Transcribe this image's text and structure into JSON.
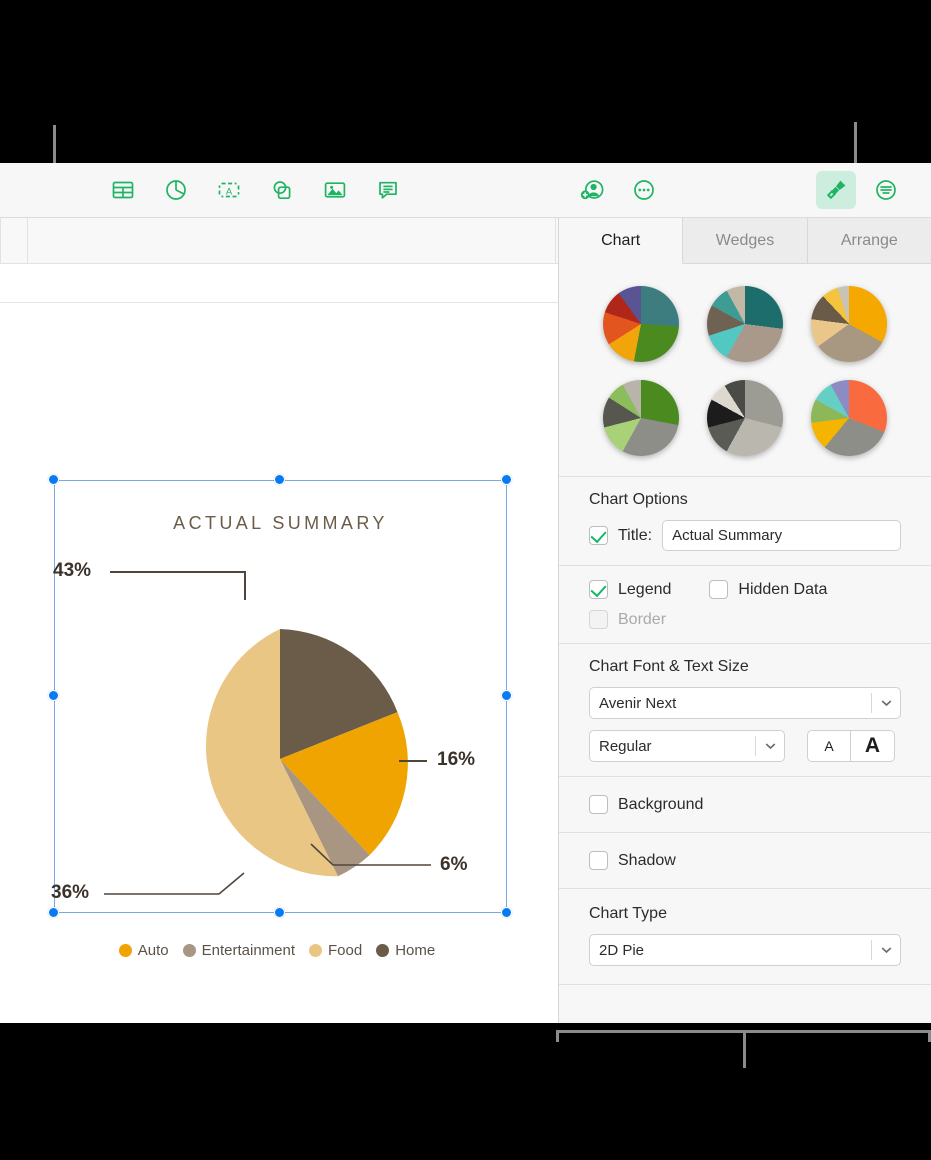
{
  "toolbar": {
    "left_items": [
      {
        "name": "table-icon",
        "label": "Table"
      },
      {
        "name": "chart-icon",
        "label": "Chart"
      },
      {
        "name": "text-box-icon",
        "label": "Text"
      },
      {
        "name": "shape-icon",
        "label": "Shape"
      },
      {
        "name": "media-icon",
        "label": "Media"
      },
      {
        "name": "comment-icon",
        "label": "Comment"
      }
    ],
    "right_items": [
      {
        "name": "collaborate-icon",
        "label": "Collaborate"
      },
      {
        "name": "more-icon",
        "label": "More"
      },
      {
        "name": "format-icon",
        "label": "Format",
        "active": true
      },
      {
        "name": "document-icon",
        "label": "Document"
      }
    ],
    "accent_color": "#1fb464",
    "active_bg": "#cdeede"
  },
  "sidebar": {
    "tabs": [
      {
        "label": "Chart",
        "active": true
      },
      {
        "label": "Wedges",
        "active": false
      },
      {
        "label": "Arrange",
        "active": false
      }
    ],
    "chart_options": {
      "heading": "Chart Options",
      "title_checkbox": {
        "label": "Title:",
        "checked": true
      },
      "title_value": "Actual Summary",
      "legend": {
        "label": "Legend",
        "checked": true
      },
      "hidden_data": {
        "label": "Hidden Data",
        "checked": false
      },
      "border": {
        "label": "Border",
        "checked": false,
        "disabled": true
      }
    },
    "font_section": {
      "heading": "Chart Font & Text Size",
      "family": "Avenir Next",
      "weight": "Regular",
      "decrease_label": "A",
      "increase_label": "A"
    },
    "background": {
      "label": "Background",
      "checked": false
    },
    "shadow": {
      "label": "Shadow",
      "checked": false
    },
    "chart_type": {
      "heading": "Chart Type",
      "value": "2D Pie"
    },
    "style_thumbnails": [
      {
        "name": "chart-style-1",
        "slices": [
          {
            "color": "#3d7d7f",
            "value": 26
          },
          {
            "color": "#4a8a1f",
            "value": 27
          },
          {
            "color": "#f2a50a",
            "value": 13
          },
          {
            "color": "#e2551f",
            "value": 14
          },
          {
            "color": "#b0271a",
            "value": 10
          },
          {
            "color": "#5b5494",
            "value": 10
          }
        ]
      },
      {
        "name": "chart-style-2",
        "slices": [
          {
            "color": "#1c6d6b",
            "value": 27
          },
          {
            "color": "#a8998a",
            "value": 31
          },
          {
            "color": "#52c8c2",
            "value": 12
          },
          {
            "color": "#6f6253",
            "value": 13
          },
          {
            "color": "#3f9c94",
            "value": 9
          },
          {
            "color": "#c3b7a6",
            "value": 8
          }
        ]
      },
      {
        "name": "chart-style-3",
        "slices": [
          {
            "color": "#f5a800",
            "value": 33
          },
          {
            "color": "#a89781",
            "value": 32
          },
          {
            "color": "#eac68a",
            "value": 12
          },
          {
            "color": "#6a5b49",
            "value": 11
          },
          {
            "color": "#f5c33e",
            "value": 7
          },
          {
            "color": "#c9c3b6",
            "value": 5
          }
        ]
      },
      {
        "name": "chart-style-4",
        "slices": [
          {
            "color": "#4a8a1f",
            "value": 28
          },
          {
            "color": "#8e8e88",
            "value": 30
          },
          {
            "color": "#a9d178",
            "value": 13
          },
          {
            "color": "#57564f",
            "value": 13
          },
          {
            "color": "#8bbd5c",
            "value": 8
          },
          {
            "color": "#b8b4a9",
            "value": 8
          }
        ]
      },
      {
        "name": "chart-style-5",
        "slices": [
          {
            "color": "#9c9c95",
            "value": 29
          },
          {
            "color": "#b9b7ae",
            "value": 29
          },
          {
            "color": "#5b5b56",
            "value": 13
          },
          {
            "color": "#1c1c1c",
            "value": 12
          },
          {
            "color": "#ddd9ce",
            "value": 8
          },
          {
            "color": "#4a4a46",
            "value": 9
          }
        ]
      },
      {
        "name": "chart-style-6",
        "slices": [
          {
            "color": "#f96a3e",
            "value": 31
          },
          {
            "color": "#8e8e88",
            "value": 30
          },
          {
            "color": "#f5b400",
            "value": 12
          },
          {
            "color": "#8cb85a",
            "value": 10
          },
          {
            "color": "#66cfc4",
            "value": 9
          },
          {
            "color": "#8e8ac4",
            "value": 8
          }
        ]
      }
    ]
  },
  "chart_data": {
    "type": "pie",
    "title": "ACTUAL SUMMARY",
    "categories": [
      "Auto",
      "Entertainment",
      "Food",
      "Home"
    ],
    "values": [
      16,
      6,
      36,
      43
    ],
    "value_labels": [
      "16%",
      "6%",
      "36%",
      "43%"
    ],
    "colors": [
      "#efa401",
      "#a99682",
      "#e9c684",
      "#6b5c4a"
    ],
    "legend": {
      "position": "bottom",
      "visible": true
    },
    "grid": false,
    "slices": [
      {
        "label": "Home",
        "value": 43,
        "display": "43%",
        "color": "#6b5c4a"
      },
      {
        "label": "Auto",
        "value": 16,
        "display": "16%",
        "color": "#efa401"
      },
      {
        "label": "Entertainment",
        "value": 6,
        "display": "6%",
        "color": "#a99682"
      },
      {
        "label": "Food",
        "value": 36,
        "display": "36%",
        "color": "#e9c684"
      }
    ]
  }
}
